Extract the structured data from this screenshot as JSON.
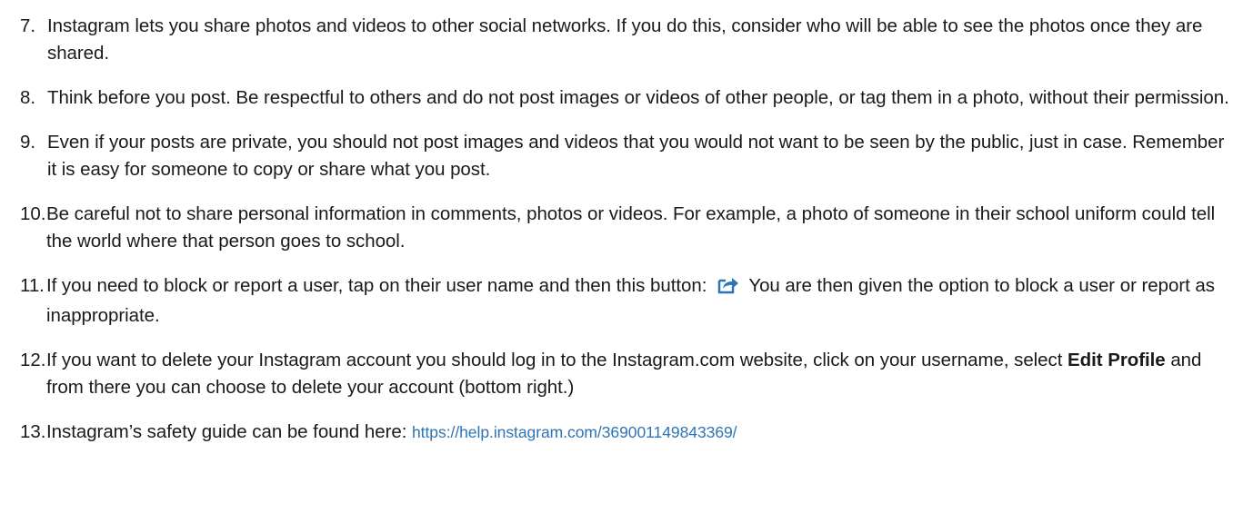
{
  "items": [
    {
      "number": "7.",
      "text": "Instagram lets you share photos and videos to other social networks. If you do this, consider who will be able to see the photos once they are shared."
    },
    {
      "number": "8.",
      "text": "Think before you post. Be respectful to others and do not post images or videos of other people, or tag them in a photo, without their permission."
    },
    {
      "number": "9.",
      "text": "Even if your posts are private, you should not post images and videos that you would not want to be seen by the public, just in case. Remember it is easy for someone to copy or share what you post."
    },
    {
      "number": "10.",
      "text": "Be careful not to share personal information in comments, photos or videos. For example, a photo of someone in their school uniform could tell the world where that person goes to school."
    },
    {
      "number": "11.",
      "text_before": "If you need to block or report a user, tap on their user name and then this button:",
      "text_after": "You are then given the option to block a user or report as inappropriate.",
      "icon": "share-arrow-icon"
    },
    {
      "number": "12.",
      "text_before": "If you want to delete your Instagram account you should log in to the Instagram.com website, click on your username, select",
      "bold": "Edit Profile",
      "text_after": "and from there you can choose to delete your account (bottom right.)"
    },
    {
      "number": "13.",
      "text": "Instagram’s safety guide can be found here:",
      "link": "https://help.instagram.com/369001149843369/"
    }
  ],
  "colors": {
    "text": "#1a1a1a",
    "link": "#2e74b5",
    "icon": "#2e74b5"
  }
}
